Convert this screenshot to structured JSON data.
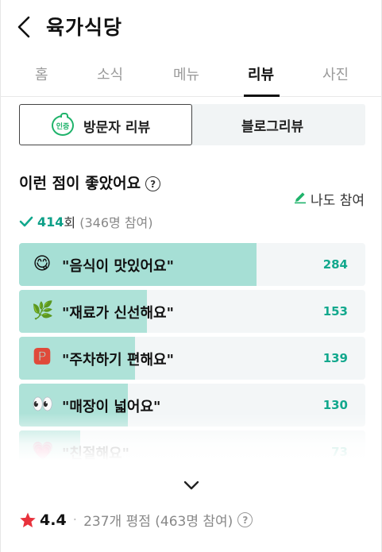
{
  "header": {
    "title": "육가식당"
  },
  "tabs": [
    {
      "label": "홈"
    },
    {
      "label": "소식"
    },
    {
      "label": "메뉴"
    },
    {
      "label": "리뷰"
    },
    {
      "label": "사진"
    }
  ],
  "review_toggle": {
    "badge": "인증",
    "visitor_label": "방문자 리뷰",
    "blog_label": "블로그리뷰"
  },
  "section": {
    "title": "이런 점이 좋았어요",
    "help": "?",
    "participate_label": "나도 참여",
    "summary_count": "414",
    "summary_unit": "회",
    "summary_participants": "(346명 참여)"
  },
  "keywords": [
    {
      "emoji": "😋",
      "label": "\"음식이 맛있어요\"",
      "count": 284
    },
    {
      "emoji": "🌿",
      "label": "\"재료가 신선해요\"",
      "count": 153
    },
    {
      "emoji": "🅿",
      "label": "\"주차하기 편해요\"",
      "count": 139
    },
    {
      "emoji": "👀",
      "label": "\"매장이 넓어요\"",
      "count": 130
    },
    {
      "emoji": "💗",
      "label": "\"친절해요\"",
      "count": 73
    }
  ],
  "rating": {
    "score": "4.4",
    "separator": "·",
    "meta": "237개 평점 (463명 참여)",
    "help": "?"
  },
  "colors": {
    "accent": "#12a88d",
    "bar_fill": "#aee2d8",
    "star": "#e8323c",
    "badge_green": "#1fb36b"
  }
}
